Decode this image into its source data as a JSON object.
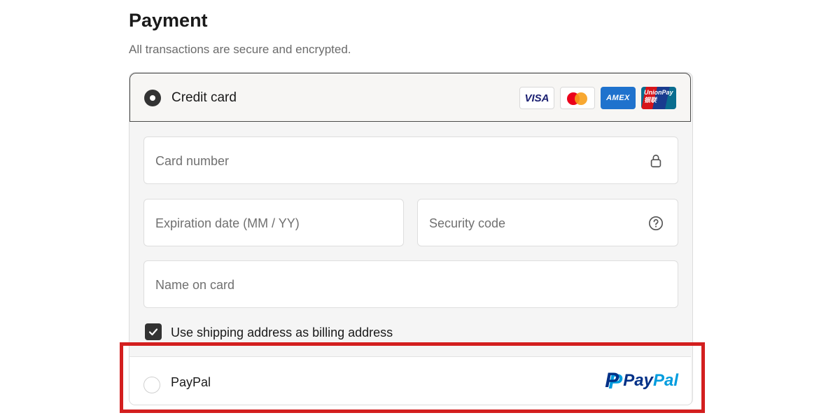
{
  "header": {
    "title": "Payment",
    "subtitle": "All transactions are secure and encrypted."
  },
  "credit_card": {
    "label": "Credit card",
    "selected": true,
    "card_logos": [
      {
        "name": "visa-logo",
        "text": "VISA"
      },
      {
        "name": "mastercard-logo",
        "text": ""
      },
      {
        "name": "amex-logo",
        "text": "AMEX"
      },
      {
        "name": "unionpay-logo",
        "text": "UnionPay 银联"
      }
    ],
    "fields": {
      "card_number": {
        "placeholder": "Card number",
        "icon": "lock-icon"
      },
      "expiration": {
        "placeholder": "Expiration date (MM / YY)"
      },
      "security_code": {
        "placeholder": "Security code",
        "icon": "help-circle-icon"
      },
      "name_on_card": {
        "placeholder": "Name on card"
      }
    },
    "billing_checkbox": {
      "label": "Use shipping address as billing address",
      "checked": true
    }
  },
  "paypal": {
    "label": "PayPal",
    "selected": false,
    "logo": {
      "mark": "P",
      "word_part1": "Pay",
      "word_part2": "Pal"
    }
  },
  "colors": {
    "highlight": "#d31f1f",
    "paypal_dark": "#003087",
    "paypal_light": "#009cde",
    "selected_radio": "#333333"
  }
}
